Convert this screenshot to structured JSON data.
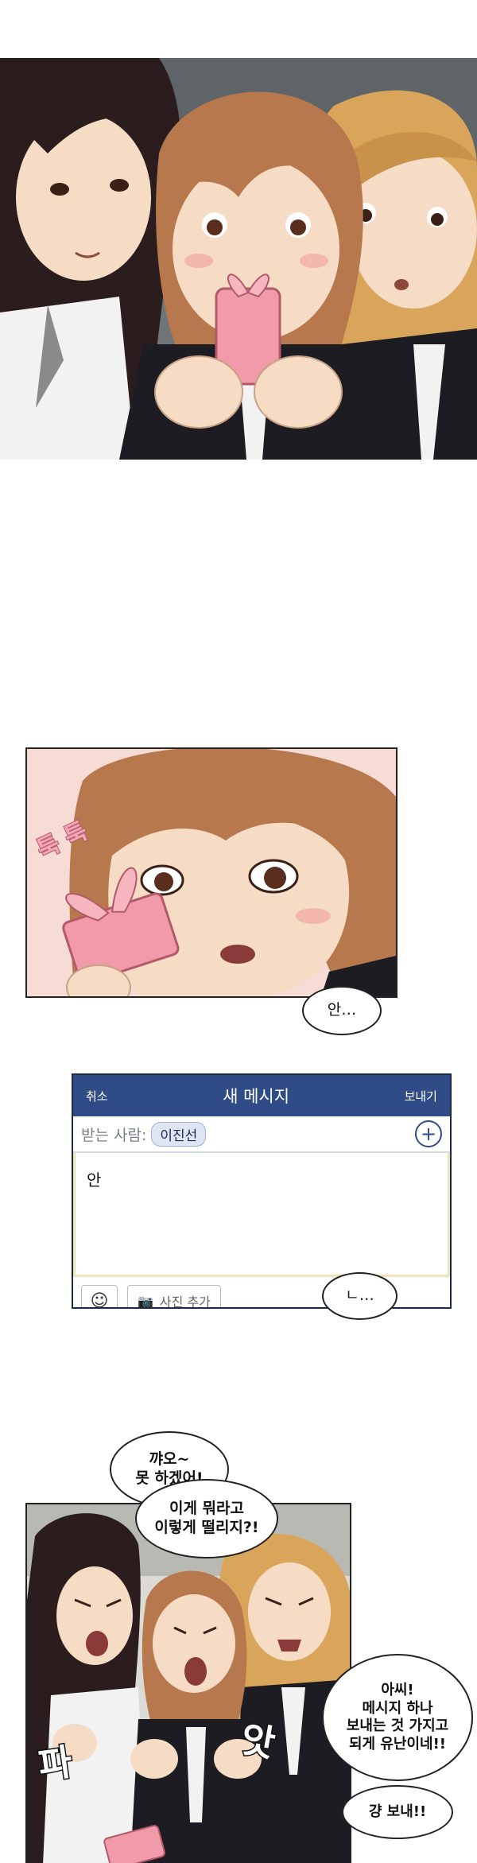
{
  "panel1": {
    "description_icon": "three-girls-looking-at-phone"
  },
  "panel2": {
    "sfx": "툭 툭",
    "bubble": "안…"
  },
  "message": {
    "cancel": "취소",
    "title": "새 메시지",
    "send": "보내기",
    "to_label": "받는 사람:",
    "recipient": "이진선",
    "plus": "+",
    "body_text": "안",
    "photo_button": "사진 추가",
    "bubble": "ㄴ…"
  },
  "panel3": {
    "bubble_a": "꺄오~\n못 하겠어!",
    "bubble_b": "이게 뭐라고\n이렇게 떨리지?!",
    "bubble_c": "아씨!\n메시지 하나\n보내는 것 가지고\n되게 유난이네!!",
    "bubble_d": "걍 보내!!",
    "sfx_left": "파",
    "sfx_right": "앗"
  },
  "colors": {
    "skin": "#f6dcc4",
    "hair_brown": "#b7784d",
    "hair_dark": "#2b1d1d",
    "hair_blonde": "#d9a55b",
    "nav_blue": "#2f4c86",
    "gift_pink": "#f19aa9"
  }
}
